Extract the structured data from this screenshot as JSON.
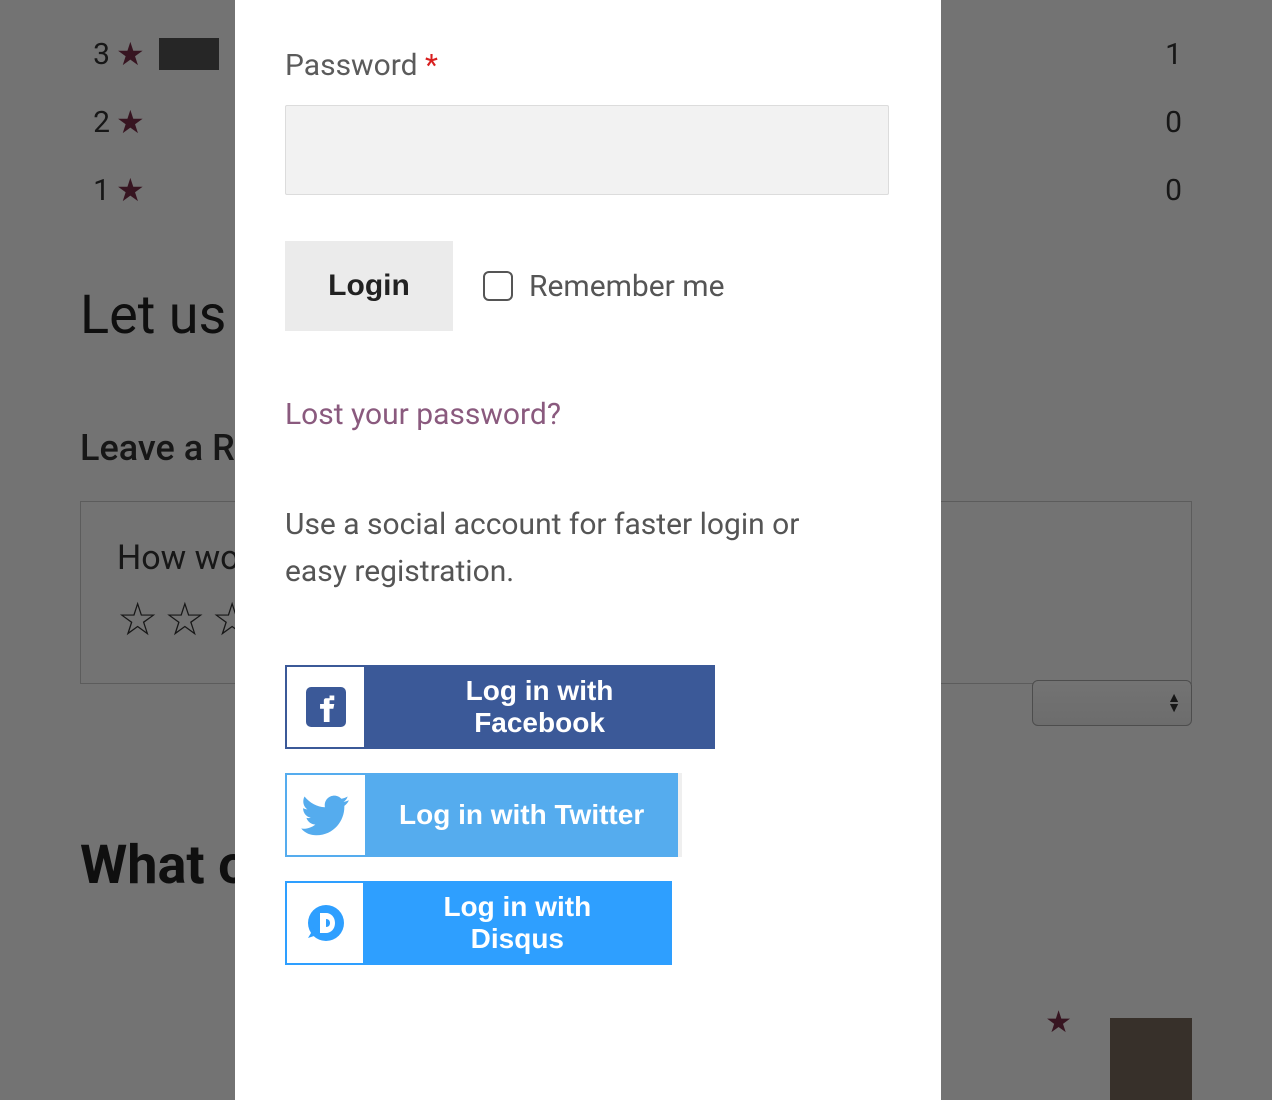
{
  "backdrop": {
    "rating_rows": [
      {
        "rating": "3",
        "count": "1",
        "bar": true
      },
      {
        "rating": "2",
        "count": "0",
        "bar": false
      },
      {
        "rating": "1",
        "count": "0",
        "bar": false
      }
    ],
    "big_heading": "Let us k",
    "sub_heading": "Leave a Rev",
    "review_prompt": "How wou",
    "what_others": "What ot"
  },
  "modal": {
    "password_label": "Password ",
    "required_marker": "*",
    "password_value": "",
    "login_label": "Login",
    "remember_label": "Remember me",
    "lost_password_label": "Lost your password?",
    "social_text": "Use a social account for faster login or easy registration.",
    "social_buttons": {
      "facebook": {
        "label": "Log in with Facebook",
        "icon": "facebook-icon",
        "color": "#3b5998"
      },
      "twitter": {
        "label": "Log in with Twitter",
        "icon": "twitter-icon",
        "color": "#55acee"
      },
      "disqus": {
        "label": "Log in with Disqus",
        "icon": "disqus-icon",
        "color": "#2e9fff"
      }
    }
  }
}
